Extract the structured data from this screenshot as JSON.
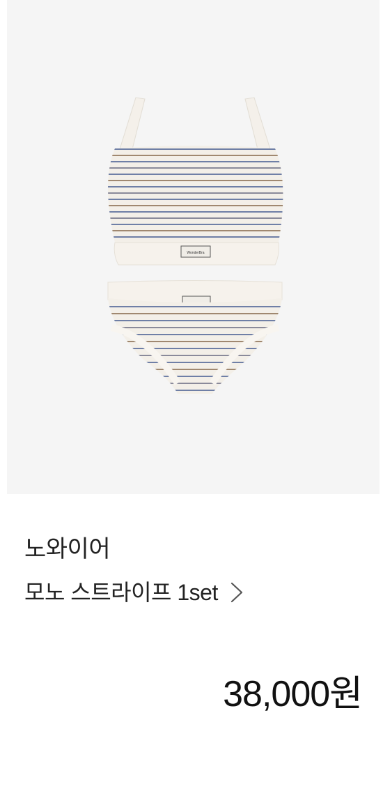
{
  "product": {
    "image_alt": "노와이어 모노 스트라이프 1set",
    "label_text": "WonderBra",
    "brand": "노와이어",
    "name": "모노 스트라이프 1set",
    "price": "38,000원"
  },
  "icons": {
    "name_link": "chevron-right-icon"
  },
  "colors": {
    "image_background": "#f5f5f5",
    "fabric_base": "#f3efe8",
    "stripe_blue": "#6f7fa6",
    "stripe_brown": "#a08870",
    "text": "#222222"
  }
}
